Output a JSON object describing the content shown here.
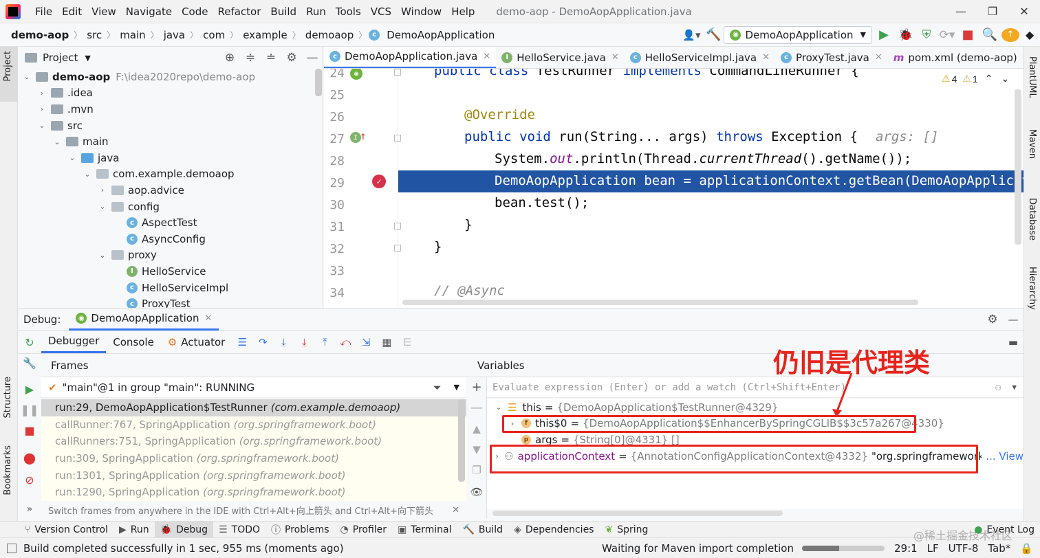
{
  "menubar": {
    "items": [
      "File",
      "Edit",
      "View",
      "Navigate",
      "Code",
      "Refactor",
      "Build",
      "Run",
      "Tools",
      "VCS",
      "Window",
      "Help"
    ],
    "title": "demo-aop - DemoAopApplication.java"
  },
  "navbar": {
    "crumbs": [
      "demo-aop",
      "src",
      "main",
      "java",
      "com",
      "example",
      "demoaop"
    ],
    "current": "DemoAopApplication",
    "run_config": "DemoAopApplication"
  },
  "project": {
    "title": "Project",
    "root": "demo-aop",
    "root_path": "F:\\idea2020repo\\demo-aop",
    "tree": [
      {
        "label": ".idea",
        "type": "folder",
        "depth": 1,
        "arrow": "›"
      },
      {
        "label": ".mvn",
        "type": "folder",
        "depth": 1,
        "arrow": "›"
      },
      {
        "label": "src",
        "type": "folder",
        "depth": 1,
        "arrow": "⌄"
      },
      {
        "label": "main",
        "type": "folder",
        "depth": 2,
        "arrow": "⌄"
      },
      {
        "label": "java",
        "type": "folder-blue",
        "depth": 3,
        "arrow": "⌄"
      },
      {
        "label": "com.example.demoaop",
        "type": "package",
        "depth": 4,
        "arrow": "⌄"
      },
      {
        "label": "aop.advice",
        "type": "package",
        "depth": 5,
        "arrow": "›"
      },
      {
        "label": "config",
        "type": "package",
        "depth": 5,
        "arrow": "⌄"
      },
      {
        "label": "AspectTest",
        "type": "class",
        "depth": 6,
        "arrow": ""
      },
      {
        "label": "AsyncConfig",
        "type": "class",
        "depth": 6,
        "arrow": ""
      },
      {
        "label": "proxy",
        "type": "package",
        "depth": 5,
        "arrow": "⌄"
      },
      {
        "label": "HelloService",
        "type": "interface",
        "depth": 6,
        "arrow": ""
      },
      {
        "label": "HelloServiceImpl",
        "type": "class",
        "depth": 6,
        "arrow": ""
      },
      {
        "label": "ProxyTest",
        "type": "class",
        "depth": 6,
        "arrow": ""
      }
    ]
  },
  "tabs": [
    "DemoAopApplication.java",
    "HelloService.java",
    "HelloServiceImpl.java",
    "ProxyTest.java",
    "pom.xml (demo-aop)"
  ],
  "editor": {
    "warnings": "4",
    "weak_warnings": "1",
    "line_numbers": [
      "24",
      "25",
      "26",
      "27",
      "28",
      "29",
      "30",
      "31",
      "32",
      "33",
      "34"
    ],
    "lines": {
      "l24_kw": "public class",
      "l24_rest": " TestRunner ",
      "l24_kw2": "implements",
      "l24_rest2": " CommandLineRunner {",
      "l26": "@Override",
      "l27_kw": "public void",
      "l27_mid": " run(String... args) ",
      "l27_kw2": "throws",
      "l27_end": " Exception {",
      "l27_hint": "args: []",
      "l28_a": "System.",
      "l28_out": "out",
      "l28_b": ".println(Thread.",
      "l28_ct": "currentThread",
      "l28_c": "().getName());",
      "l29": "DemoAopApplication bean = applicationContext.getBean(DemoAopApplicatio",
      "l30": "bean.test();",
      "l31": "}",
      "l32": "}",
      "l34": "// @Async"
    }
  },
  "debug": {
    "label": "Debug:",
    "session": "DemoAopApplication",
    "tabs": [
      "Debugger",
      "Console",
      "Actuator"
    ],
    "frames_title": "Frames",
    "thread": "\"main\"@1 in group \"main\": RUNNING",
    "frames": [
      {
        "loc": "run:29, DemoAopApplication$TestRunner",
        "pkg": "(com.example.demoaop)"
      },
      {
        "loc": "callRunner:767, SpringApplication",
        "pkg": "(org.springframework.boot)"
      },
      {
        "loc": "callRunners:751, SpringApplication",
        "pkg": "(org.springframework.boot)"
      },
      {
        "loc": "run:309, SpringApplication",
        "pkg": "(org.springframework.boot)"
      },
      {
        "loc": "run:1301, SpringApplication",
        "pkg": "(org.springframework.boot)"
      },
      {
        "loc": "run:1290, SpringApplication",
        "pkg": "(org.springframework.boot)"
      }
    ],
    "frames_hint": "Switch frames from anywhere in the IDE with Ctrl+Alt+向上箭头 and Ctrl+Alt+向下箭头",
    "variables_title": "Variables",
    "eval_placeholder": "Evaluate expression (Enter) or add a watch (Ctrl+Shift+Enter)",
    "vars": {
      "this_name": "this",
      "this_val": "{DemoAopApplication$TestRunner@4329}",
      "this0_name": "this$0",
      "this0_val": "{DemoAopApplication$$EnhancerBySpringCGLIB$$3c57a267@4330}",
      "args_name": "args",
      "args_val": "{String[0]@4331} []",
      "ctx_name": "applicationContext",
      "ctx_val": "{AnnotationConfigApplicationContext@4332}",
      "ctx_str": "\"org.springframework.context.ar",
      "ctx_view": "... View"
    },
    "annotation": "仍旧是代理类"
  },
  "bottom_tabs": [
    "Version Control",
    "Run",
    "Debug",
    "TODO",
    "Problems",
    "Profiler",
    "Terminal",
    "Build",
    "Dependencies",
    "Spring"
  ],
  "event_log": "Event Log",
  "status": {
    "left": "Build completed successfully in 1 sec, 955 ms (moments ago)",
    "maven": "Waiting for Maven import completion",
    "pos": "29:1",
    "lf": "LF",
    "enc": "UTF-8",
    "indent": "Tab*",
    "watermark": "@稀土掘金技术社区"
  },
  "left_stripe": {
    "project": "Project",
    "structure": "Structure",
    "bookmarks": "Bookmarks"
  },
  "right_stripe": [
    "PlantUML",
    "Maven",
    "Database",
    "Hierarchy"
  ],
  "colors": {
    "accent": "#3574f0",
    "highlight": "#2154a3",
    "red_box": "#e8231c",
    "run_green": "#3fa34d"
  }
}
